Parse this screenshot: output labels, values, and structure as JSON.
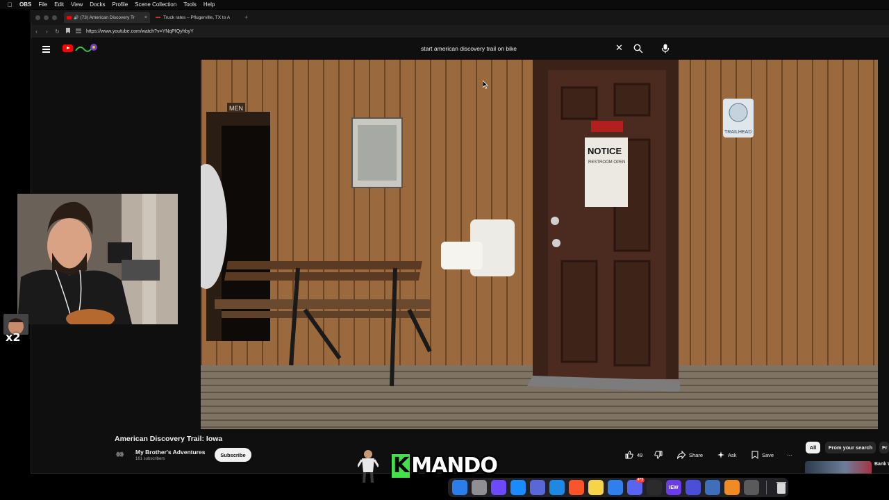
{
  "menubar": {
    "app": "OBS",
    "items": [
      "File",
      "Edit",
      "View",
      "Docks",
      "Profile",
      "Scene Collection",
      "Tools",
      "Help"
    ]
  },
  "browser": {
    "tabs": [
      {
        "label": "(73) American Discovery Tr",
        "active": true
      },
      {
        "label": "Truck rates – Pflugerville, TX to A",
        "active": false
      }
    ],
    "url": "https://www.youtube.com/watch?v=YNqPIQyhbyY"
  },
  "youtube": {
    "search_query": "start american discovery trail on bike",
    "video": {
      "title": "American Discovery Trail: Iowa",
      "channel_icon_text": "ꙮꙮ",
      "channel": "My Brother's Adventures",
      "subscribers": "161 subscribers",
      "subscribe_label": "Subscribe",
      "like_count": "49",
      "share_label": "Share",
      "ask_label": "Ask",
      "save_label": "Save",
      "more_label": "⋯"
    },
    "video_scene": {
      "sign_men": "MEN",
      "notice_title": "NOTICE",
      "notice_sub": "RESTROOM OPEN",
      "trailhead": "TRAILHEAD"
    },
    "chips": [
      "All",
      "From your search",
      "Fr"
    ],
    "recommendation_title": "Bank What"
  },
  "overlay": {
    "multiplier": "x2",
    "brand_k": "K",
    "brand_rest": "MANDO"
  },
  "dock": {
    "apps": [
      {
        "name": "finder-icon",
        "color": "#2b7de9"
      },
      {
        "name": "system-settings-icon",
        "color": "#8e8e93"
      },
      {
        "name": "proton-icon",
        "color": "#6d4aff"
      },
      {
        "name": "app-store-icon",
        "color": "#1a8cff"
      },
      {
        "name": "arc-icon",
        "color": "#5a67d8"
      },
      {
        "name": "safari-icon",
        "color": "#1e88e5"
      },
      {
        "name": "brave-icon",
        "color": "#fb542b"
      },
      {
        "name": "notes-icon",
        "color": "#f5d44a"
      },
      {
        "name": "mail-icon",
        "color": "#2f80ed"
      },
      {
        "name": "discord-icon",
        "color": "#5865f2",
        "badge": "473"
      },
      {
        "name": "obs-icon",
        "color": "#2b2b2b"
      },
      {
        "name": "iew-icon",
        "color": "#6a3de8",
        "text": "IEW"
      },
      {
        "name": "launchpad-icon",
        "color": "#4a4fd8"
      },
      {
        "name": "finder-2-icon",
        "color": "#3e6fb8"
      },
      {
        "name": "vlc-icon",
        "color": "#f08a24"
      },
      {
        "name": "utility-icon",
        "color": "#5a5a5a"
      }
    ]
  }
}
